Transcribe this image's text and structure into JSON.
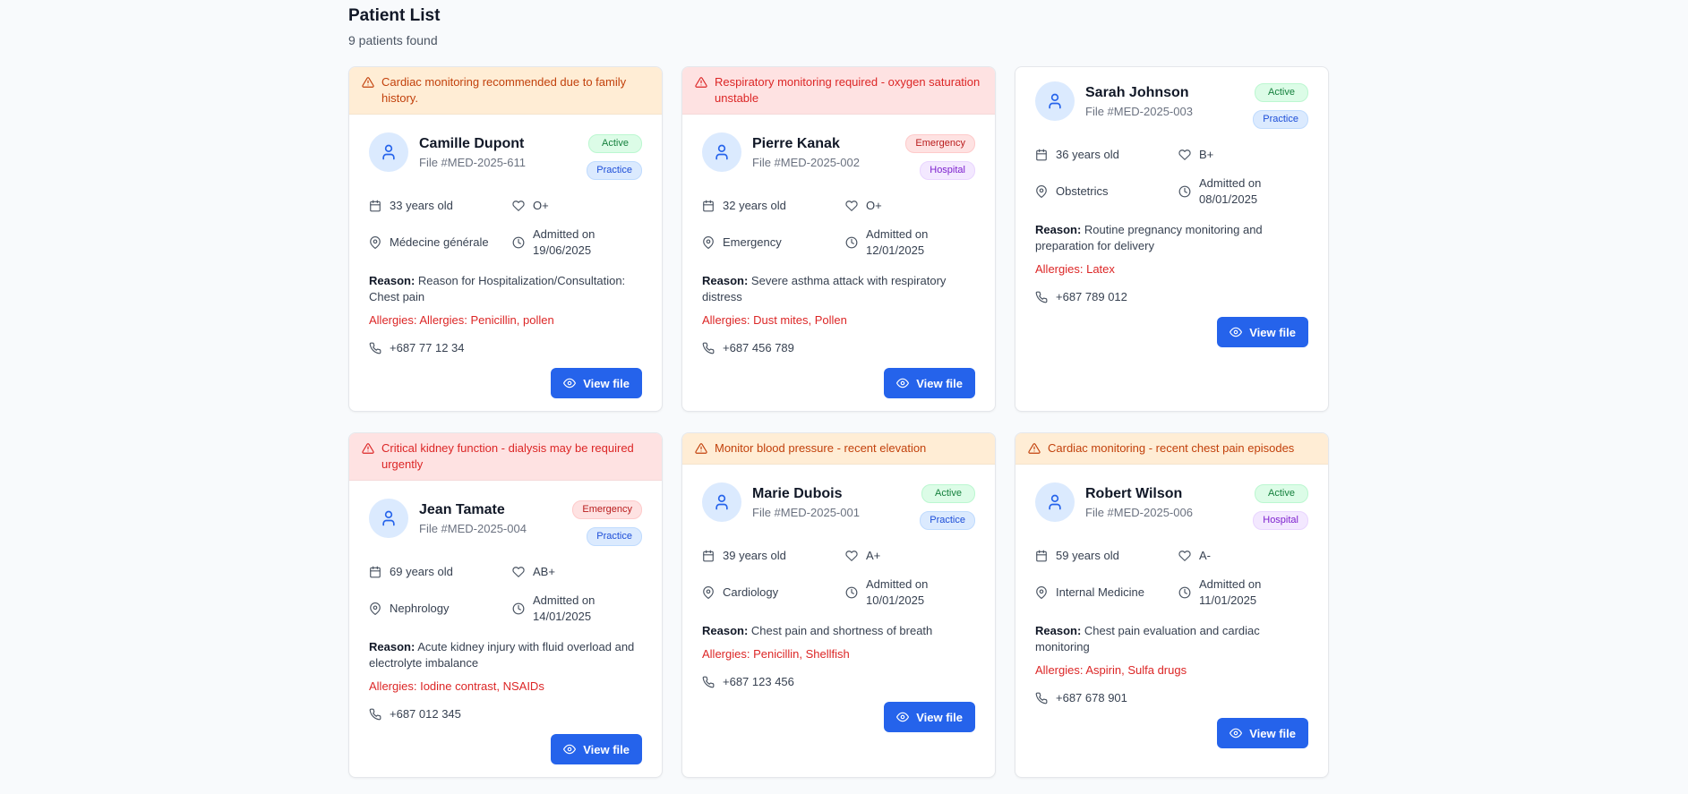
{
  "page": {
    "title": "Patient List",
    "subtitle": "9 patients found"
  },
  "labels": {
    "reason": "Reason:",
    "allergies": "Allergies:",
    "view_file": "View file"
  },
  "colors": {
    "primary": "#2563eb",
    "warn_bg": "#ffedd5",
    "warn_text": "#c2410c",
    "danger_bg": "#fee2e2",
    "danger_text": "#dc2626"
  },
  "patients": [
    {
      "alert": {
        "level": "warn",
        "text": "Cardiac monitoring recommended due to family history."
      },
      "name": "Camille Dupont",
      "file": "File #MED-2025-611",
      "status": "Active",
      "type": "Practice",
      "age": "33 years old",
      "blood": "O+",
      "department": "Médecine générale",
      "admitted": "Admitted on 19/06/2025",
      "reason": "Reason for Hospitalization/Consultation: Chest pain",
      "allergies": "Allergies: Penicillin, pollen",
      "phone": "+687 77 12 34"
    },
    {
      "alert": {
        "level": "danger",
        "text": "Respiratory monitoring required - oxygen saturation unstable"
      },
      "name": "Pierre Kanak",
      "file": "File #MED-2025-002",
      "status": "Emergency",
      "type": "Hospital",
      "age": "32 years old",
      "blood": "O+",
      "department": "Emergency",
      "admitted": "Admitted on 12/01/2025",
      "reason": "Severe asthma attack with respiratory distress",
      "allergies": "Dust mites, Pollen",
      "phone": "+687 456 789"
    },
    {
      "alert": null,
      "name": "Sarah Johnson",
      "file": "File #MED-2025-003",
      "status": "Active",
      "type": "Practice",
      "age": "36 years old",
      "blood": "B+",
      "department": "Obstetrics",
      "admitted": "Admitted on 08/01/2025",
      "reason": "Routine pregnancy monitoring and preparation for delivery",
      "allergies": "Latex",
      "phone": "+687 789 012"
    },
    {
      "alert": {
        "level": "danger",
        "text": "Critical kidney function - dialysis may be required urgently"
      },
      "name": "Jean Tamate",
      "file": "File #MED-2025-004",
      "status": "Emergency",
      "type": "Practice",
      "age": "69 years old",
      "blood": "AB+",
      "department": "Nephrology",
      "admitted": "Admitted on 14/01/2025",
      "reason": "Acute kidney injury with fluid overload and electrolyte imbalance",
      "allergies": "Iodine contrast, NSAIDs",
      "phone": "+687 012 345"
    },
    {
      "alert": {
        "level": "warn",
        "text": "Monitor blood pressure - recent elevation"
      },
      "name": "Marie Dubois",
      "file": "File #MED-2025-001",
      "status": "Active",
      "type": "Practice",
      "age": "39 years old",
      "blood": "A+",
      "department": "Cardiology",
      "admitted": "Admitted on 10/01/2025",
      "reason": "Chest pain and shortness of breath",
      "allergies": "Penicillin, Shellfish",
      "phone": "+687 123 456"
    },
    {
      "alert": {
        "level": "warn",
        "text": "Cardiac monitoring - recent chest pain episodes"
      },
      "name": "Robert Wilson",
      "file": "File #MED-2025-006",
      "status": "Active",
      "type": "Hospital",
      "age": "59 years old",
      "blood": "A-",
      "department": "Internal Medicine",
      "admitted": "Admitted on 11/01/2025",
      "reason": "Chest pain evaluation and cardiac monitoring",
      "allergies": "Aspirin, Sulfa drugs",
      "phone": "+687 678 901"
    }
  ]
}
